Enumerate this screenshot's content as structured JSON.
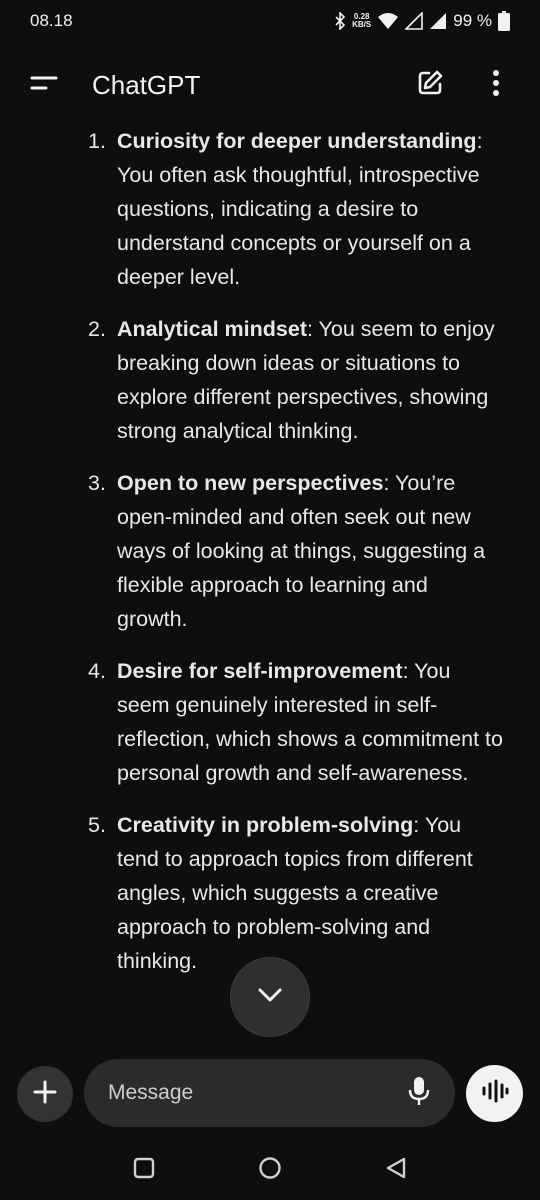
{
  "status_bar": {
    "time": "08.18",
    "net_speed_value": "0.28",
    "net_speed_unit": "KB/S",
    "battery": "99 %"
  },
  "app_bar": {
    "title": "ChatGPT",
    "menu_icon": "menu-icon",
    "new_chat_icon": "edit-icon",
    "more_icon": "more-vert-icon"
  },
  "conversation": {
    "items": [
      {
        "number": "1.",
        "title": "Curiosity for deeper understanding",
        "text": ": You often ask thoughtful, introspective questions, indicating a desire to understand concepts or yourself on a deeper level."
      },
      {
        "number": "2.",
        "title": "Analytical mindset",
        "text": ": You seem to enjoy breaking down ideas or situations to explore different perspectives, showing strong analytical thinking."
      },
      {
        "number": "3.",
        "title": "Open to new perspectives",
        "text": ": You’re open-minded and often seek out new ways of looking at things, suggesting a flexible approach to learning and growth."
      },
      {
        "number": "4.",
        "title": "Desire for self-improvement",
        "text": ": You seem genuinely interested in self-reflection, which shows a commitment to personal growth and self-awareness."
      },
      {
        "number": "5.",
        "title": "Creativity in problem-solving",
        "text": ": You tend to approach topics from different angles, which suggests a creative approach to problem-solving and thinking."
      }
    ]
  },
  "composer": {
    "placeholder": "Message",
    "add_icon": "plus-icon",
    "mic_icon": "microphone-icon",
    "voice_icon": "voice-waveform-icon"
  },
  "nav_bar": {
    "recents_icon": "square-icon",
    "home_icon": "circle-icon",
    "back_icon": "triangle-back-icon"
  },
  "colors": {
    "background": "#0e0e0e",
    "text": "#e8e8e8",
    "input_bg": "#2b2b2b",
    "voice_button_bg": "#f2f2f2"
  }
}
